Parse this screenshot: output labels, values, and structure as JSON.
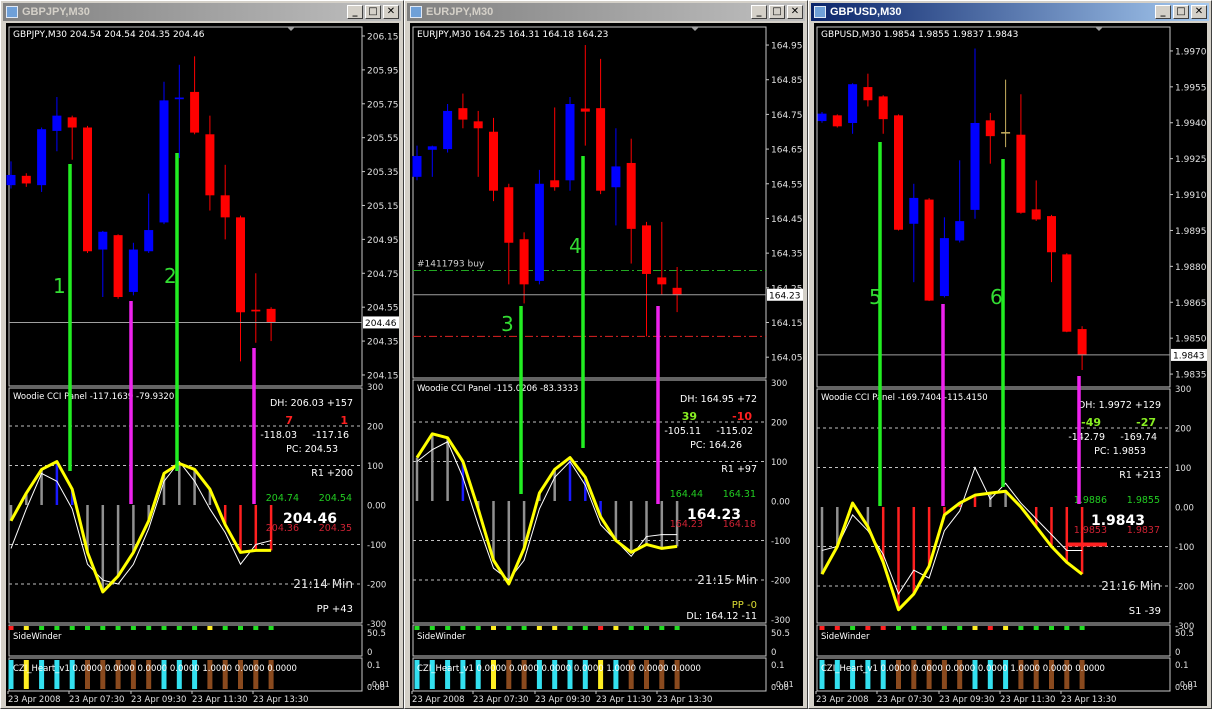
{
  "colors": {
    "bull": "#0000ff",
    "bear": "#ff0000",
    "signal_buy": "#22ee22",
    "signal_sell": "#ee22ee",
    "cci_line": "#ffff00",
    "cci_trend": "#ffffff",
    "grid": "#c0c0c0",
    "label_green": "#33dd33"
  },
  "time_labels": [
    "23 Apr 2008",
    "23 Apr 07:30",
    "23 Apr 09:30",
    "23 Apr 11:30",
    "23 Apr 13:30"
  ],
  "windows": [
    {
      "title": "GBPJPY,M30",
      "active": false,
      "buttons": {
        "minimize": "_",
        "maximize": "□",
        "close": "✕"
      },
      "info": "GBPJPY,M30  204.54 204.54 204.35 204.46",
      "ylim": [
        204.085,
        206.203
      ],
      "price_ticks": [
        "206.15",
        "205.95",
        "205.75",
        "205.55",
        "205.35",
        "205.15",
        "204.95",
        "204.75",
        "204.55",
        "204.35",
        "204.15"
      ],
      "current_price": "204.46",
      "candles": [
        [
          205.27,
          205.41,
          205.25,
          205.33
        ],
        [
          205.325,
          205.34,
          205.26,
          205.28
        ],
        [
          205.27,
          205.61,
          205.23,
          205.6
        ],
        [
          205.59,
          205.79,
          205.47,
          205.68
        ],
        [
          205.67,
          205.68,
          205.42,
          205.61
        ],
        [
          205.61,
          205.62,
          204.87,
          204.88
        ],
        [
          204.89,
          205.0,
          204.61,
          204.995
        ],
        [
          204.975,
          204.98,
          204.6,
          204.61
        ],
        [
          204.64,
          204.93,
          204.62,
          204.89
        ],
        [
          204.88,
          205.22,
          204.87,
          205.005
        ],
        [
          205.05,
          205.88,
          205.04,
          205.77
        ],
        [
          205.777,
          205.98,
          205.43,
          205.787
        ],
        [
          205.82,
          206.03,
          205.57,
          205.58
        ],
        [
          205.57,
          205.68,
          205.12,
          205.21
        ],
        [
          205.21,
          205.39,
          204.95,
          205.08
        ],
        [
          205.08,
          205.09,
          204.23,
          204.52
        ],
        [
          204.535,
          204.75,
          204.34,
          204.525
        ],
        [
          204.54,
          204.55,
          204.35,
          204.46
        ]
      ],
      "candle_color_overrides": {},
      "signal_labels": [
        "1",
        "2"
      ],
      "order_lines": [],
      "cci": {
        "title": "Woodie CCI Panel -117.1639 -79.9320",
        "ticks": [
          "300",
          "200",
          "100",
          "0.00",
          "-100",
          "-200",
          "-300"
        ],
        "cci": [
          -40,
          30,
          90,
          110,
          40,
          -120,
          -220,
          -180,
          -120,
          -40,
          80,
          105,
          90,
          40,
          -50,
          -120,
          -115,
          -115
        ],
        "tcci": [
          -110,
          -10,
          80,
          60,
          -10,
          -150,
          -190,
          -200,
          -150,
          -60,
          60,
          110,
          60,
          -10,
          -70,
          -150,
          -100,
          -90
        ],
        "hist_colors": [
          "g",
          "g",
          "g",
          "b",
          "b",
          "g",
          "g",
          "g",
          "g",
          "g",
          "g",
          "g",
          "g",
          "g",
          "r",
          "r",
          "r",
          "r"
        ],
        "panel": {
          "dh": "DH: 206.03 +157",
          "a": "7",
          "b": "1",
          "a_color": "#ff2020",
          "b_color": "#ff2020",
          "c": "-118.03",
          "d": "-117.16",
          "pc": "PC: 204.53",
          "r1": "R1 +200",
          "hi1": "204.74",
          "hi2": "204.54",
          "price": "204.46",
          "lo1": "204.36",
          "lo2": "204.35",
          "timer": "21:14 Min",
          "pivot": "PP +43",
          "pivot_color": "#ffffff",
          "extra": ""
        }
      },
      "sidewinder": {
        "label": "SideWinder",
        "ticks": [
          "50.5",
          "0"
        ],
        "dots": [
          "r",
          "y",
          "g",
          "g",
          "g",
          "g",
          "g",
          "g",
          "g",
          "g",
          "g",
          "g",
          "g",
          "y",
          "g",
          "g",
          "g",
          "g"
        ]
      },
      "czi": {
        "label": "CZI_Heart_v1 0.0000 0.0000 0.0000 0.0000 1.0000 0.0000 0.0000",
        "ticks": [
          "0.1",
          "0.00",
          "-0.01"
        ],
        "bars": [
          "c",
          "y",
          "c",
          "c",
          "c",
          "b",
          "b",
          "b",
          "b",
          "b",
          "c",
          "c",
          "c",
          "b",
          "b",
          "b",
          "b",
          "b"
        ]
      }
    },
    {
      "title": "EURJPY,M30",
      "active": false,
      "buttons": {
        "minimize": "_",
        "maximize": "□",
        "close": "✕"
      },
      "info": "EURJPY,M30  164.25 164.31 164.18 164.23",
      "ylim": [
        163.99,
        165.002
      ],
      "price_ticks": [
        "164.95",
        "164.85",
        "164.75",
        "164.65",
        "164.55",
        "164.45",
        "164.35",
        "164.25",
        "164.15",
        "164.05"
      ],
      "current_price": "164.23",
      "candles": [
        [
          164.57,
          164.66,
          164.56,
          164.63
        ],
        [
          164.648,
          164.66,
          164.57,
          164.658
        ],
        [
          164.65,
          164.78,
          164.64,
          164.76
        ],
        [
          164.768,
          164.81,
          164.71,
          164.735
        ],
        [
          164.73,
          164.76,
          164.57,
          164.71
        ],
        [
          164.7,
          164.74,
          164.5,
          164.53
        ],
        [
          164.54,
          164.55,
          164.26,
          164.38
        ],
        [
          164.39,
          164.41,
          164.205,
          164.26
        ],
        [
          164.27,
          164.59,
          164.26,
          164.55
        ],
        [
          164.56,
          164.77,
          164.53,
          164.54
        ],
        [
          164.56,
          164.8,
          164.53,
          164.78
        ],
        [
          164.767,
          164.95,
          164.66,
          164.758
        ],
        [
          164.768,
          164.91,
          164.52,
          164.53
        ],
        [
          164.54,
          164.71,
          164.43,
          164.6
        ],
        [
          164.61,
          164.68,
          164.32,
          164.42
        ],
        [
          164.43,
          164.44,
          164.11,
          164.29
        ],
        [
          164.28,
          164.44,
          164.23,
          164.26
        ],
        [
          164.25,
          164.31,
          164.18,
          164.23
        ]
      ],
      "candle_color_overrides": {},
      "signal_labels": [
        "3",
        "4"
      ],
      "order_lines": [
        {
          "label": "#1411793 buy",
          "price": 164.3,
          "color": "#22aa22"
        },
        {
          "label": "",
          "price": 164.11,
          "color": "#dd2222"
        }
      ],
      "cci": {
        "title": "Woodie CCI Panel -115.0206 -83.3333",
        "ticks": [
          "300",
          "200",
          "100",
          "0.00",
          "-100",
          "-200",
          "-300"
        ],
        "cci": [
          110,
          170,
          160,
          100,
          -20,
          -150,
          -210,
          -120,
          20,
          80,
          110,
          60,
          -40,
          -100,
          -130,
          -110,
          -120,
          -115
        ],
        "tcci": [
          100,
          130,
          150,
          60,
          -60,
          -170,
          -200,
          -150,
          -20,
          60,
          100,
          40,
          -60,
          -100,
          -140,
          -90,
          -85,
          -85
        ],
        "hist_colors": [
          "g",
          "g",
          "g",
          "b",
          "g",
          "g",
          "g",
          "g",
          "g",
          "g",
          "b",
          "b",
          "b",
          "g",
          "g",
          "g",
          "g",
          "g"
        ],
        "panel": {
          "dh": "DH: 164.95 +72",
          "a": "39",
          "b": "-10",
          "a_color": "#88ee22",
          "b_color": "#ff2020",
          "c": "-105.11",
          "d": "-115.02",
          "pc": "PC: 164.26",
          "r1": "R1 +97",
          "hi1": "164.44",
          "hi2": "164.31",
          "price": "164.23",
          "lo1": "164.23",
          "lo2": "164.18",
          "timer": "21:15 Min",
          "pivot": "PP -0",
          "pivot_color": "#dddd33",
          "extra": "DL: 164.12 -11"
        }
      },
      "sidewinder": {
        "label": "SideWinder",
        "ticks": [
          "50.5",
          "0"
        ],
        "dots": [
          "g",
          "g",
          "g",
          "g",
          "g",
          "y",
          "g",
          "g",
          "y",
          "y",
          "g",
          "g",
          "r",
          "y",
          "g",
          "g",
          "g",
          "g"
        ]
      },
      "czi": {
        "label": "CZI_Heart_v1 0.0000 0.0000 0.0000 0.0000 1.0000 0.0000 0.0000",
        "ticks": [
          "0.1",
          "0.00",
          "-0.01"
        ],
        "bars": [
          "c",
          "c",
          "c",
          "c",
          "c",
          "y",
          "b",
          "b",
          "c",
          "c",
          "c",
          "c",
          "y",
          "c",
          "b",
          "b",
          "b",
          "b"
        ]
      }
    },
    {
      "title": "GBPUSD,M30",
      "active": true,
      "buttons": {
        "minimize": "_",
        "maximize": "□",
        "close": "✕"
      },
      "info": "GBPUSD,M30  1.9854 1.9855 1.9837 1.9843",
      "ylim": [
        1.98296,
        1.998
      ],
      "price_ticks": [
        "1.9970",
        "1.9955",
        "1.9940",
        "1.9925",
        "1.9910",
        "1.9895",
        "1.9880",
        "1.9865",
        "1.9850",
        "1.9835"
      ],
      "current_price": "1.9843",
      "candles": [
        [
          1.99407,
          1.99445,
          1.994,
          1.99438
        ],
        [
          1.99431,
          1.99435,
          1.9938,
          1.99385
        ],
        [
          1.99399,
          1.99565,
          1.99354,
          1.99561
        ],
        [
          1.99549,
          1.99605,
          1.99468,
          1.99494
        ],
        [
          1.9951,
          1.99515,
          1.99354,
          1.99415
        ],
        [
          1.99431,
          1.99435,
          1.9895,
          1.98953
        ],
        [
          1.98978,
          1.99145,
          1.98734,
          1.99086
        ],
        [
          1.99079,
          1.99085,
          1.98655,
          1.98657
        ],
        [
          1.98676,
          1.99005,
          1.9867,
          1.98918
        ],
        [
          1.98908,
          1.99243,
          1.989,
          1.98989
        ],
        [
          1.99036,
          1.9971,
          1.98999,
          1.99399
        ],
        [
          1.9941,
          1.99441,
          1.99229,
          1.99344
        ],
        [
          1.99361,
          1.9958,
          1.99298,
          1.99361
        ],
        [
          1.9935,
          1.99519,
          1.9902,
          1.99024
        ],
        [
          1.99038,
          1.99159,
          1.9899,
          1.98996
        ],
        [
          1.9901,
          1.99015,
          1.98734,
          1.98859
        ],
        [
          1.9885,
          1.98855,
          1.98525,
          1.98527
        ],
        [
          1.98538,
          1.9855,
          1.98367,
          1.98431
        ]
      ],
      "candle_color_overrides": {
        "12": "#c8b060"
      },
      "signal_labels": [
        "5",
        "6"
      ],
      "order_lines": [],
      "cci": {
        "title": "Woodie CCI Panel -169.7404 -115.4150",
        "ticks": [
          "300",
          "200",
          "100",
          "0.00",
          "-100",
          "-200",
          "-300"
        ],
        "cci": [
          -170,
          -100,
          10,
          -50,
          -140,
          -260,
          -220,
          -150,
          -20,
          10,
          30,
          35,
          40,
          0,
          -50,
          -100,
          -140,
          -170
        ],
        "tcci": [
          -110,
          -100,
          -20,
          -60,
          -120,
          -220,
          -160,
          -180,
          -60,
          -10,
          100,
          20,
          60,
          10,
          -30,
          -70,
          -110,
          -110
        ],
        "hist_colors": [
          "g",
          "g",
          "r",
          "g",
          "r",
          "r",
          "r",
          "r",
          "r",
          "r",
          "r",
          "g",
          "g",
          "r",
          "r",
          "r",
          "r",
          "r"
        ],
        "panel": {
          "dh": "DH: 1.9972 +129",
          "a": "-49",
          "b": "-27",
          "a_color": "#88ee22",
          "b_color": "#88ee22",
          "c": "-142.79",
          "d": "-169.74",
          "pc": "PC: 1.9853",
          "r1": "R1 +213",
          "hi1": "1.9886",
          "hi2": "1.9855",
          "price": "1.9843",
          "lo1": "1.9853",
          "lo2": "1.9837",
          "timer": "21:16 Min",
          "pivot": "S1 -39",
          "pivot_color": "#ffffff",
          "extra": ""
        }
      },
      "sidewinder": {
        "label": "SideWinder",
        "ticks": [
          "50.5",
          "0"
        ],
        "dots": [
          "r",
          "r",
          "g",
          "r",
          "r",
          "g",
          "g",
          "g",
          "g",
          "g",
          "y",
          "r",
          "y",
          "g",
          "g",
          "g",
          "g",
          "g"
        ]
      },
      "czi": {
        "label": "CZI_Heart_v1 0.0000 0.0000 0.0000 0.0000 1.0000 0.0000 0.0000",
        "ticks": [
          "0.1",
          "0.00",
          "-0.01"
        ],
        "bars": [
          "c",
          "c",
          "c",
          "c",
          "c",
          "b",
          "b",
          "b",
          "b",
          "b",
          "c",
          "c",
          "c",
          "b",
          "b",
          "b",
          "b",
          "b"
        ]
      }
    }
  ]
}
